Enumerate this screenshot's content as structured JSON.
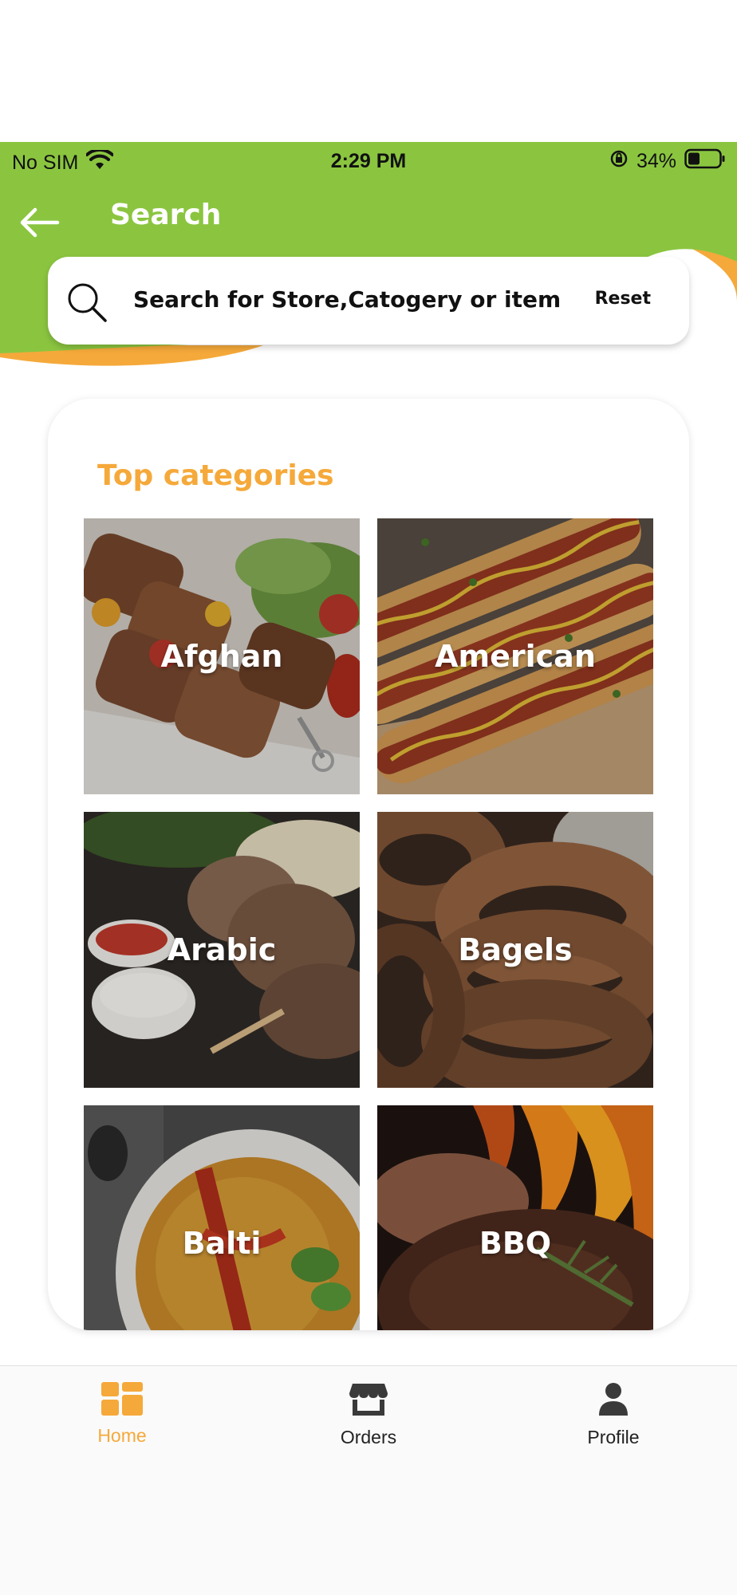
{
  "status_bar": {
    "carrier": "No SIM",
    "time": "2:29 PM",
    "battery": "34%"
  },
  "header": {
    "title": "Search",
    "back_icon": "arrow-left-icon"
  },
  "search": {
    "placeholder": "Search for Store,Catogery or item",
    "reset_label": "Reset",
    "icon": "search-icon"
  },
  "categories": {
    "title": "Top categories",
    "items": [
      {
        "label": "Afghan"
      },
      {
        "label": "American"
      },
      {
        "label": "Arabic"
      },
      {
        "label": "Bagels"
      },
      {
        "label": "Balti"
      },
      {
        "label": "BBQ"
      }
    ]
  },
  "bottom_nav": {
    "items": [
      {
        "label": "Home",
        "icon": "dashboard-icon",
        "active": true
      },
      {
        "label": "Orders",
        "icon": "store-icon",
        "active": false
      },
      {
        "label": "Profile",
        "icon": "user-icon",
        "active": false
      }
    ]
  },
  "colors": {
    "header_green": "#8bc540",
    "accent_orange": "#f5a93a",
    "text_dark": "#111111"
  }
}
